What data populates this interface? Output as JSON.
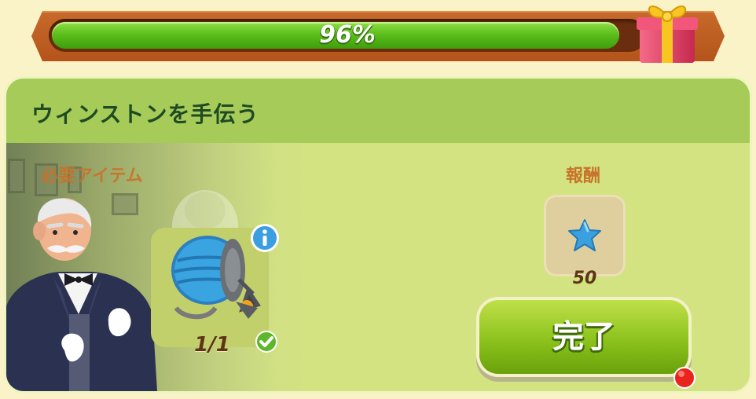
{
  "progress": {
    "percent_text": "96%",
    "value": 0.96
  },
  "panel": {
    "title": "ウィンストンを手伝う"
  },
  "required": {
    "label": "必要アイテム",
    "item_count": "1/1",
    "item_icon": "garden-hose-icon"
  },
  "reward": {
    "label": "報酬",
    "amount": "50",
    "icon": "blue-star-icon"
  },
  "complete_button": {
    "label": "完了"
  },
  "colors": {
    "accent_green": "#8cc21c",
    "header_orange": "#c76a2a",
    "panel_green": "#d3e382",
    "title_text": "#1e4a24",
    "label_orange": "#c9722a"
  }
}
